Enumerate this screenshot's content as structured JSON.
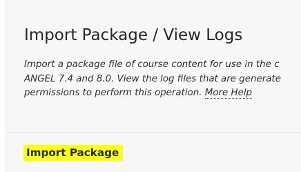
{
  "header": {
    "title": "Import Package / View Logs"
  },
  "description": {
    "line1": "Import a package file of course content for use in the c",
    "line2": "ANGEL 7.4 and 8.0. View the log files that are generate",
    "line3": "permissions to perform this operation.",
    "more_help": "More Help"
  },
  "actions": {
    "import_package": "Import Package"
  },
  "colors": {
    "panel_background": "#f7f7f7",
    "highlight": "#fbff1e",
    "text": "#2b2b2b"
  }
}
